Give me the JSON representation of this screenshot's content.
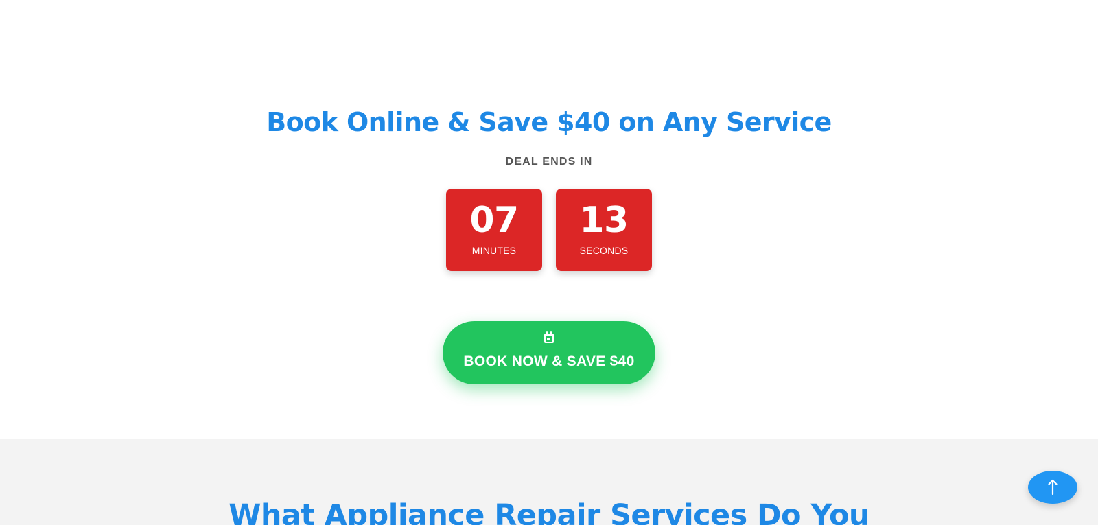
{
  "promo": {
    "headline": "Book Online & Save $40 on Any Service",
    "deal_label": "DEAL ENDS IN",
    "countdown": {
      "minutes": {
        "value": "07",
        "unit": "MINUTES"
      },
      "seconds": {
        "value": "13",
        "unit": "SECONDS"
      }
    },
    "cta": {
      "label": "BOOK NOW & SAVE $40",
      "icon": "calendar-icon"
    }
  },
  "services": {
    "title": "What Appliance Repair Services Do You"
  },
  "back_to_top": {
    "icon": "arrow-up-icon"
  },
  "colors": {
    "accent_blue": "#1e88e5",
    "countdown_red": "#dc2626",
    "cta_green": "#22c55e",
    "section_gray": "#f3f3f3",
    "back_to_top_blue": "#2196f3"
  }
}
